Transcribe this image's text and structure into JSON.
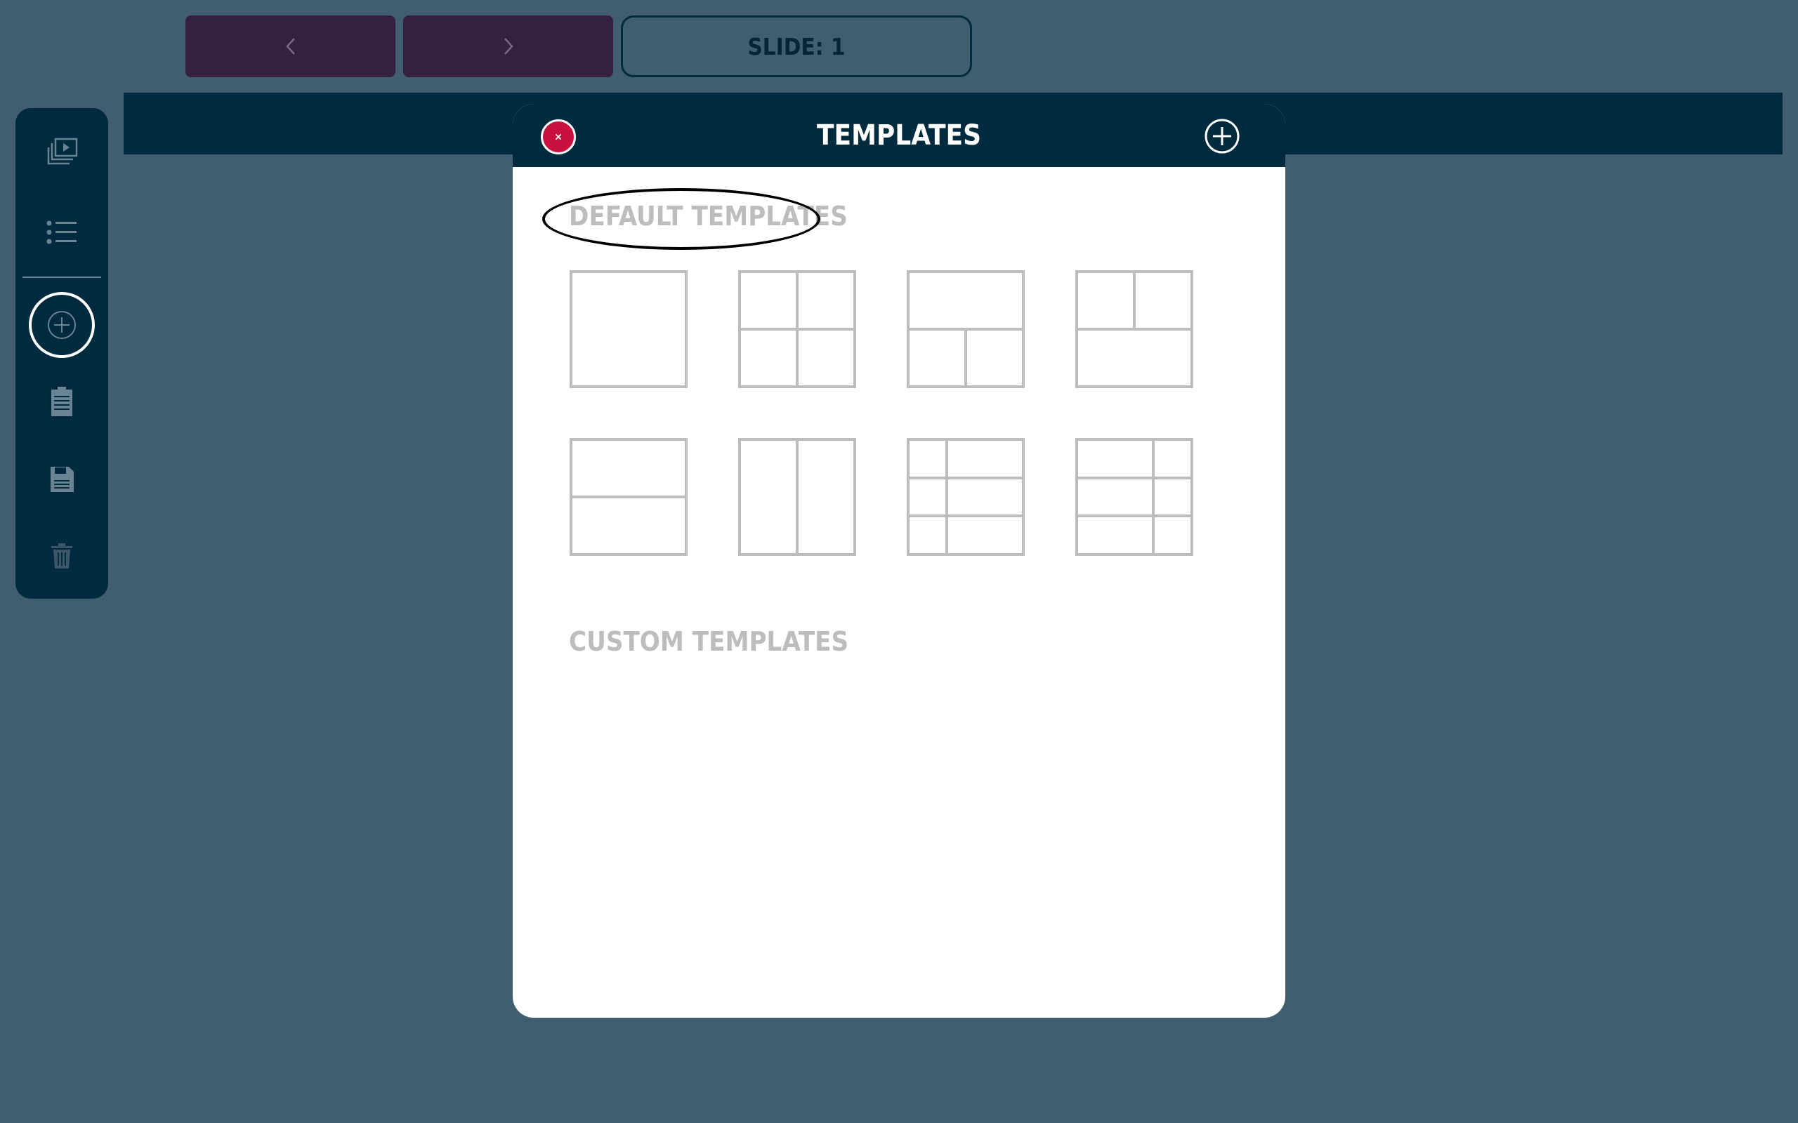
{
  "topbar": {
    "prev_icon": "chevron-left-icon",
    "next_icon": "chevron-right-icon",
    "slide_label": "SLIDE: 1"
  },
  "sidebar": {
    "items": [
      {
        "icon": "slideshow-icon"
      },
      {
        "icon": "list-icon"
      },
      {
        "icon": "add-circle-icon",
        "active": true
      },
      {
        "icon": "clipboard-icon"
      },
      {
        "icon": "save-icon"
      },
      {
        "icon": "trash-icon"
      }
    ]
  },
  "dialog": {
    "title": "TEMPLATES",
    "close_icon": "close-icon",
    "add_icon": "add-circle-icon",
    "default_section": "DEFAULT TEMPLATES",
    "custom_section": "CUSTOM TEMPLATES",
    "default_templates": [
      "single",
      "quad-grid",
      "top-full-bottom-split",
      "top-split-bottom-full",
      "horizontal-halves",
      "vertical-halves",
      "three-rows-left-narrow",
      "three-rows-right-narrow"
    ]
  },
  "colors": {
    "background": "#405e70",
    "navy": "#002a3e",
    "nav_button": "#362040",
    "close_red": "#c8113f",
    "template_stroke": "#bdbdbd"
  }
}
